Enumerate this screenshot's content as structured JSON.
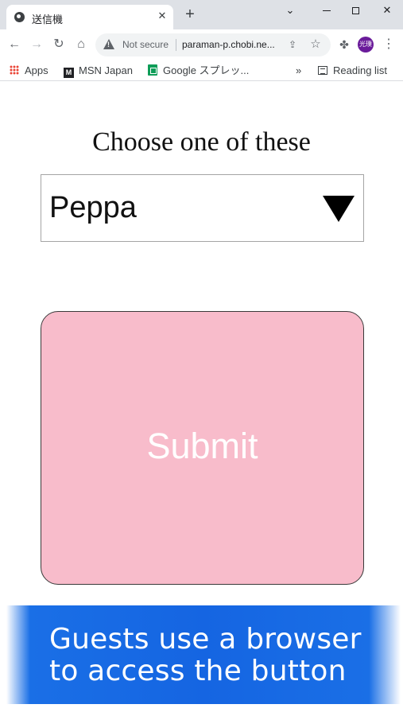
{
  "browser": {
    "tab_title": "送信機",
    "tab_close_glyph": "✕",
    "new_tab_glyph": "+",
    "security_label": "Not secure",
    "url": "paraman-p.chobi.ne...",
    "avatar_text": "光璞",
    "bookmarks": [
      {
        "label": "Apps",
        "icon": "apps-grid-icon"
      },
      {
        "label": "MSN Japan",
        "icon": "msn-icon"
      },
      {
        "label": "Google スプレッ...",
        "icon": "google-sheets-icon"
      }
    ],
    "bookmarks_overflow": "»",
    "reading_list_label": "Reading list"
  },
  "page": {
    "prompt": "Choose one of these",
    "select": {
      "selected_value": "Peppa"
    },
    "submit_label": "Submit",
    "button_color": "#f8bccb"
  },
  "caption": {
    "line1": "Guests use a browser",
    "line2": "to access  the button",
    "background": "#1565e2"
  }
}
